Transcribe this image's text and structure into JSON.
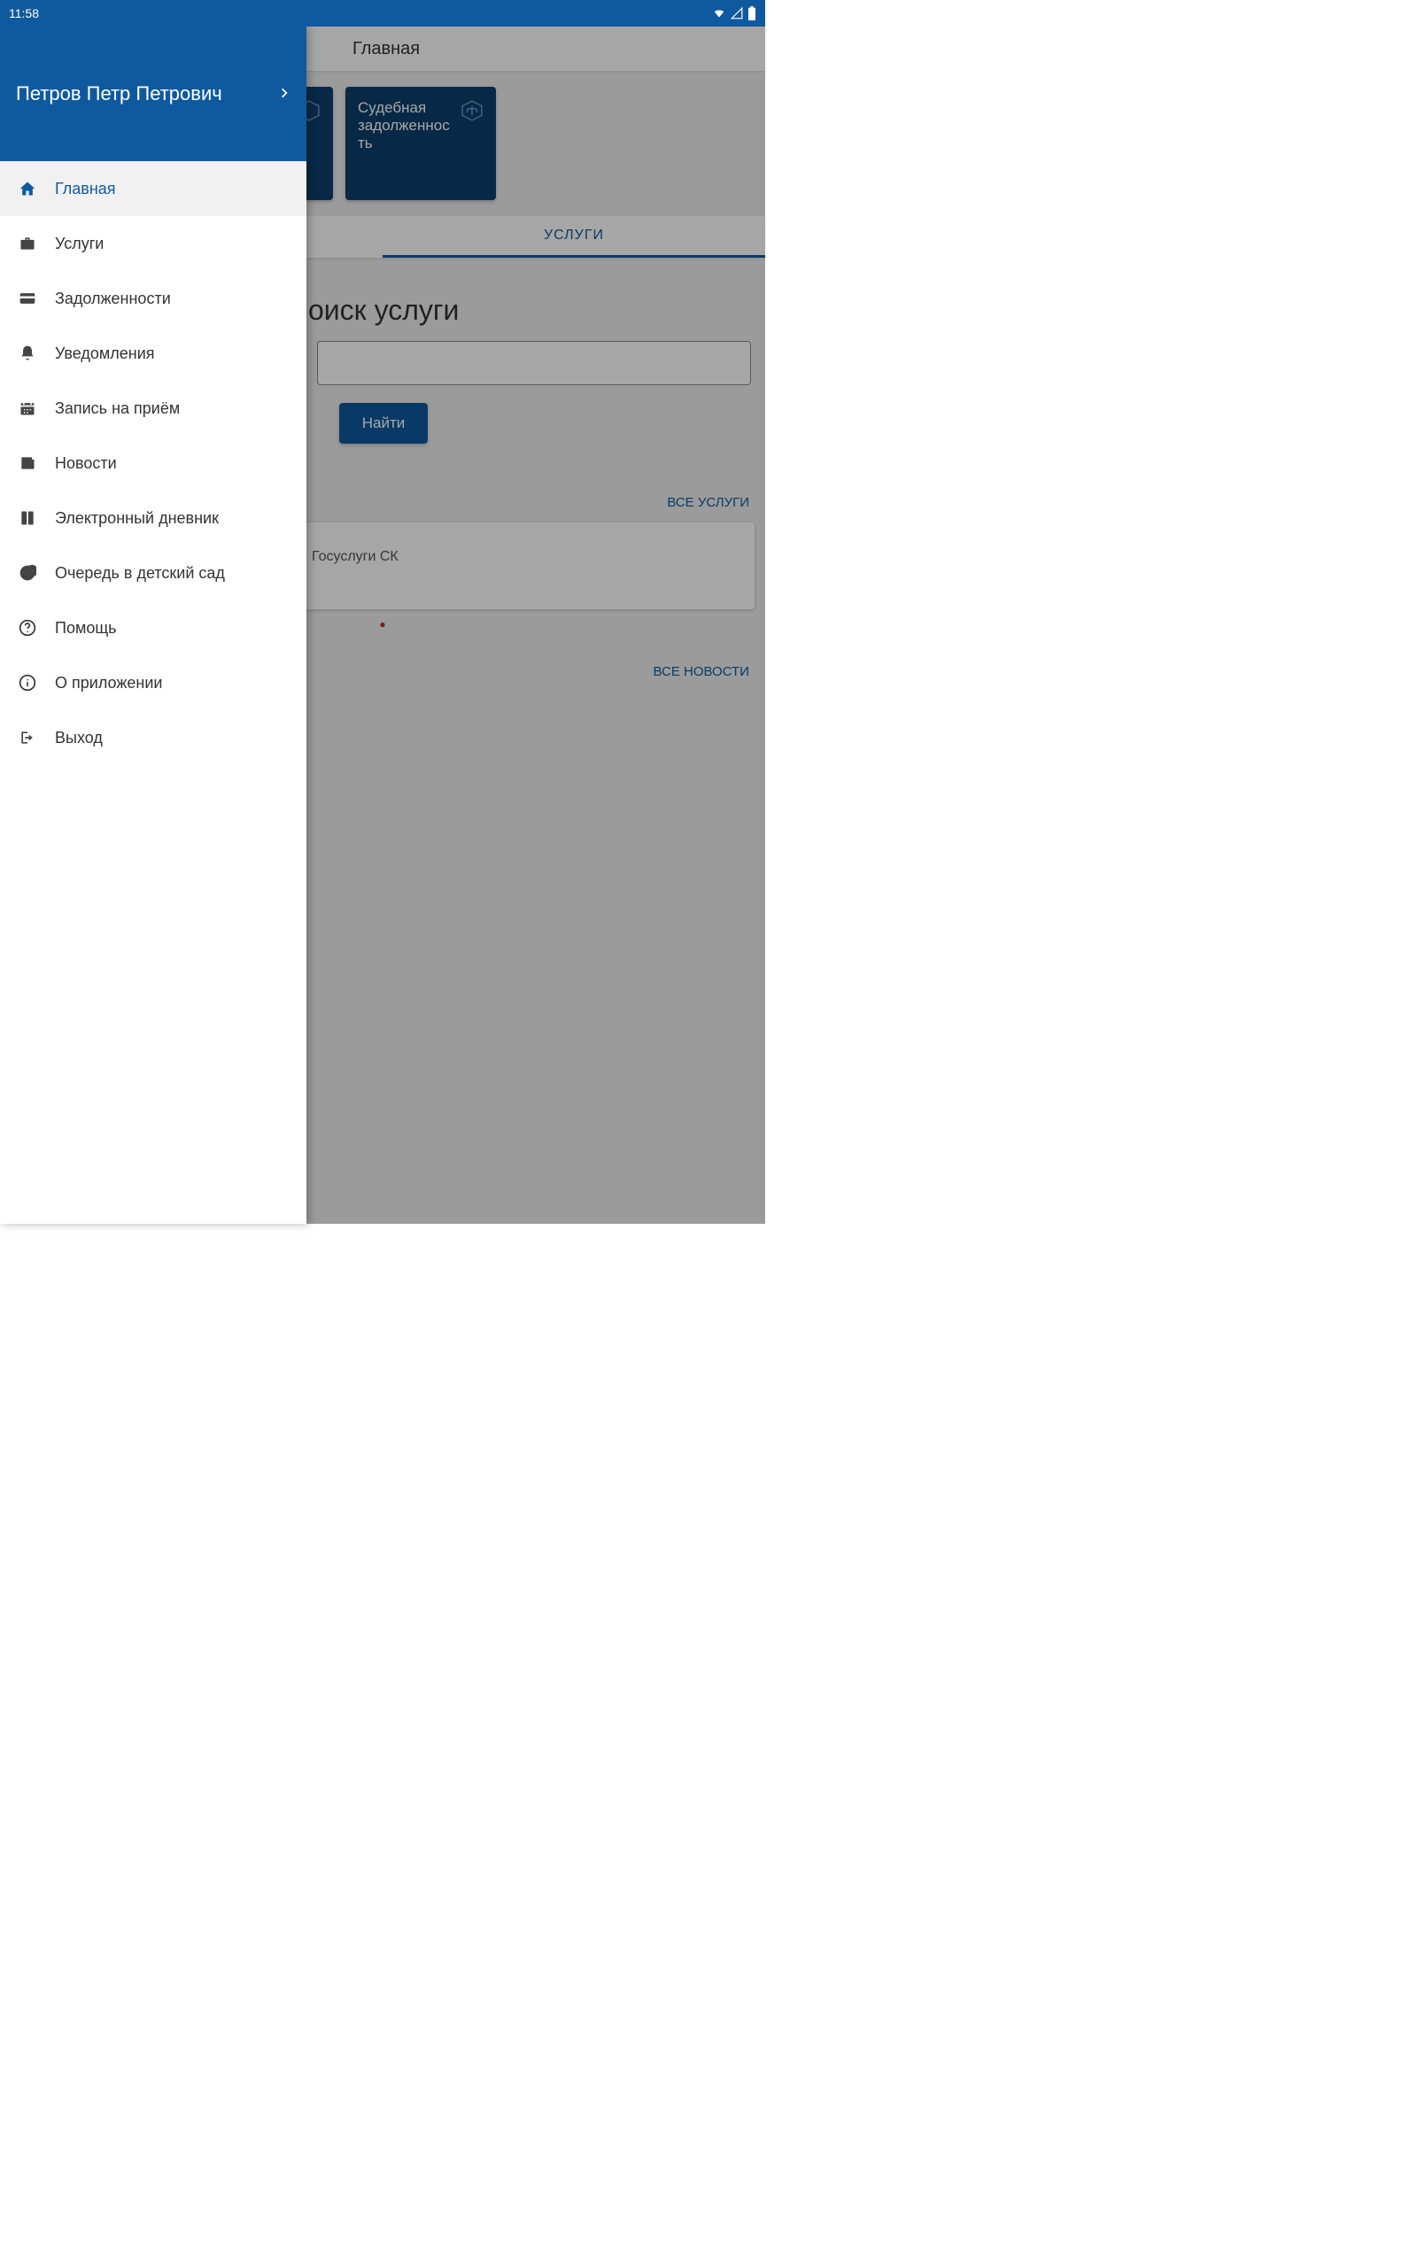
{
  "status": {
    "time": "11:58"
  },
  "app_bar": {
    "title": "Главная"
  },
  "cards": {
    "debt": {
      "line1": "Судебная",
      "line2": "задолженнос",
      "line3": "ть"
    }
  },
  "tabs": {
    "services": "УСЛУГИ"
  },
  "search": {
    "title_visible": "оиск услуги",
    "button": "Найти"
  },
  "links": {
    "all_services": "ВСЕ УСЛУГИ",
    "all_news": "ВСЕ НОВОСТИ"
  },
  "news": {
    "item1": "Госуслуги СК"
  },
  "drawer": {
    "user_name": "Петров Петр Петрович",
    "items": [
      {
        "label": "Главная",
        "icon": "home",
        "active": true
      },
      {
        "label": "Услуги",
        "icon": "briefcase",
        "active": false
      },
      {
        "label": "Задолженности",
        "icon": "card",
        "active": false
      },
      {
        "label": "Уведомления",
        "icon": "bell",
        "active": false
      },
      {
        "label": "Запись на приём",
        "icon": "calendar",
        "active": false
      },
      {
        "label": "Новости",
        "icon": "news",
        "active": false
      },
      {
        "label": "Электронный дневник",
        "icon": "diary",
        "active": false
      },
      {
        "label": "Очередь в детский сад",
        "icon": "pie",
        "active": false
      },
      {
        "label": "Помощь",
        "icon": "help",
        "active": false
      },
      {
        "label": "О приложении",
        "icon": "info",
        "active": false
      },
      {
        "label": "Выход",
        "icon": "exit",
        "active": false
      }
    ]
  }
}
